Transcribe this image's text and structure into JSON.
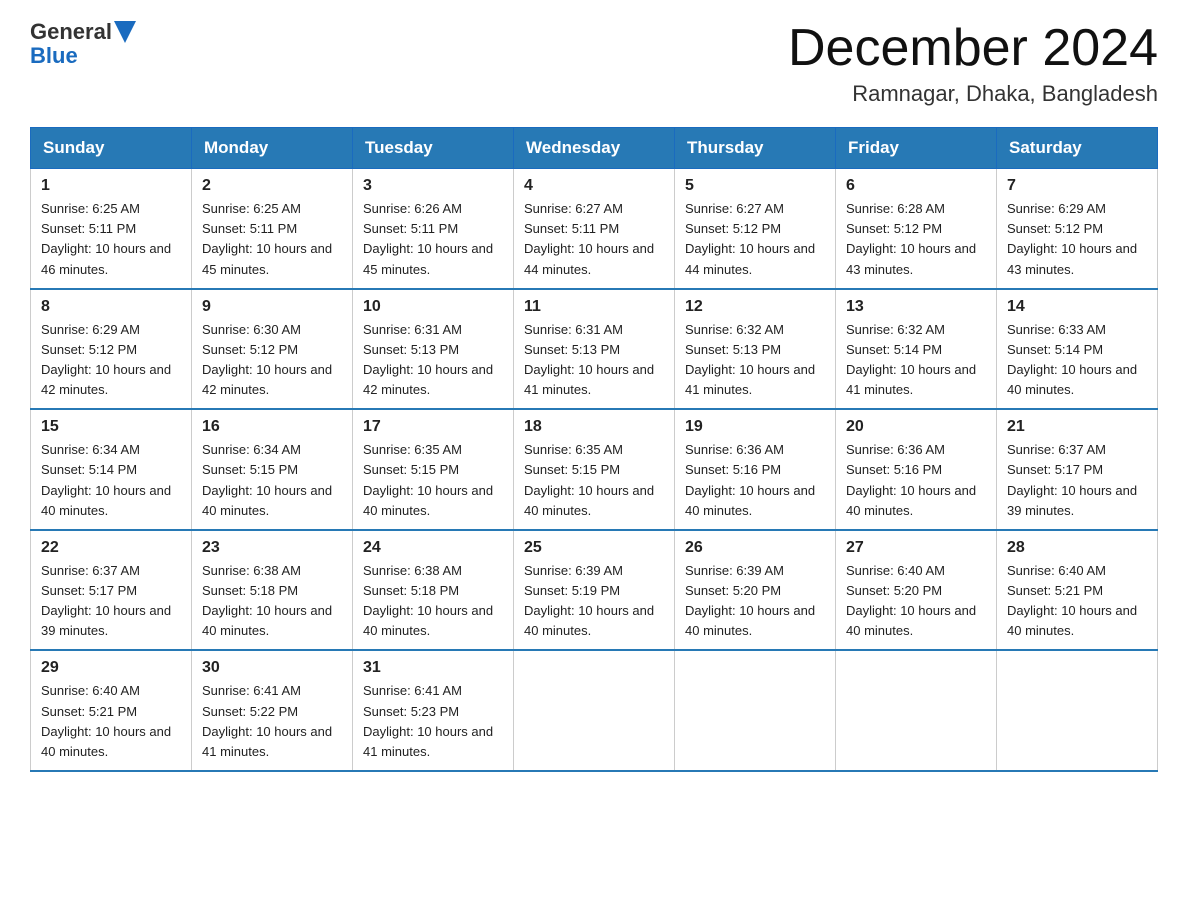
{
  "header": {
    "logo_general": "General",
    "logo_blue": "Blue",
    "month_title": "December 2024",
    "location": "Ramnagar, Dhaka, Bangladesh"
  },
  "days_of_week": [
    "Sunday",
    "Monday",
    "Tuesday",
    "Wednesday",
    "Thursday",
    "Friday",
    "Saturday"
  ],
  "weeks": [
    [
      {
        "day": "1",
        "sunrise": "6:25 AM",
        "sunset": "5:11 PM",
        "daylight": "10 hours and 46 minutes."
      },
      {
        "day": "2",
        "sunrise": "6:25 AM",
        "sunset": "5:11 PM",
        "daylight": "10 hours and 45 minutes."
      },
      {
        "day": "3",
        "sunrise": "6:26 AM",
        "sunset": "5:11 PM",
        "daylight": "10 hours and 45 minutes."
      },
      {
        "day": "4",
        "sunrise": "6:27 AM",
        "sunset": "5:11 PM",
        "daylight": "10 hours and 44 minutes."
      },
      {
        "day": "5",
        "sunrise": "6:27 AM",
        "sunset": "5:12 PM",
        "daylight": "10 hours and 44 minutes."
      },
      {
        "day": "6",
        "sunrise": "6:28 AM",
        "sunset": "5:12 PM",
        "daylight": "10 hours and 43 minutes."
      },
      {
        "day": "7",
        "sunrise": "6:29 AM",
        "sunset": "5:12 PM",
        "daylight": "10 hours and 43 minutes."
      }
    ],
    [
      {
        "day": "8",
        "sunrise": "6:29 AM",
        "sunset": "5:12 PM",
        "daylight": "10 hours and 42 minutes."
      },
      {
        "day": "9",
        "sunrise": "6:30 AM",
        "sunset": "5:12 PM",
        "daylight": "10 hours and 42 minutes."
      },
      {
        "day": "10",
        "sunrise": "6:31 AM",
        "sunset": "5:13 PM",
        "daylight": "10 hours and 42 minutes."
      },
      {
        "day": "11",
        "sunrise": "6:31 AM",
        "sunset": "5:13 PM",
        "daylight": "10 hours and 41 minutes."
      },
      {
        "day": "12",
        "sunrise": "6:32 AM",
        "sunset": "5:13 PM",
        "daylight": "10 hours and 41 minutes."
      },
      {
        "day": "13",
        "sunrise": "6:32 AM",
        "sunset": "5:14 PM",
        "daylight": "10 hours and 41 minutes."
      },
      {
        "day": "14",
        "sunrise": "6:33 AM",
        "sunset": "5:14 PM",
        "daylight": "10 hours and 40 minutes."
      }
    ],
    [
      {
        "day": "15",
        "sunrise": "6:34 AM",
        "sunset": "5:14 PM",
        "daylight": "10 hours and 40 minutes."
      },
      {
        "day": "16",
        "sunrise": "6:34 AM",
        "sunset": "5:15 PM",
        "daylight": "10 hours and 40 minutes."
      },
      {
        "day": "17",
        "sunrise": "6:35 AM",
        "sunset": "5:15 PM",
        "daylight": "10 hours and 40 minutes."
      },
      {
        "day": "18",
        "sunrise": "6:35 AM",
        "sunset": "5:15 PM",
        "daylight": "10 hours and 40 minutes."
      },
      {
        "day": "19",
        "sunrise": "6:36 AM",
        "sunset": "5:16 PM",
        "daylight": "10 hours and 40 minutes."
      },
      {
        "day": "20",
        "sunrise": "6:36 AM",
        "sunset": "5:16 PM",
        "daylight": "10 hours and 40 minutes."
      },
      {
        "day": "21",
        "sunrise": "6:37 AM",
        "sunset": "5:17 PM",
        "daylight": "10 hours and 39 minutes."
      }
    ],
    [
      {
        "day": "22",
        "sunrise": "6:37 AM",
        "sunset": "5:17 PM",
        "daylight": "10 hours and 39 minutes."
      },
      {
        "day": "23",
        "sunrise": "6:38 AM",
        "sunset": "5:18 PM",
        "daylight": "10 hours and 40 minutes."
      },
      {
        "day": "24",
        "sunrise": "6:38 AM",
        "sunset": "5:18 PM",
        "daylight": "10 hours and 40 minutes."
      },
      {
        "day": "25",
        "sunrise": "6:39 AM",
        "sunset": "5:19 PM",
        "daylight": "10 hours and 40 minutes."
      },
      {
        "day": "26",
        "sunrise": "6:39 AM",
        "sunset": "5:20 PM",
        "daylight": "10 hours and 40 minutes."
      },
      {
        "day": "27",
        "sunrise": "6:40 AM",
        "sunset": "5:20 PM",
        "daylight": "10 hours and 40 minutes."
      },
      {
        "day": "28",
        "sunrise": "6:40 AM",
        "sunset": "5:21 PM",
        "daylight": "10 hours and 40 minutes."
      }
    ],
    [
      {
        "day": "29",
        "sunrise": "6:40 AM",
        "sunset": "5:21 PM",
        "daylight": "10 hours and 40 minutes."
      },
      {
        "day": "30",
        "sunrise": "6:41 AM",
        "sunset": "5:22 PM",
        "daylight": "10 hours and 41 minutes."
      },
      {
        "day": "31",
        "sunrise": "6:41 AM",
        "sunset": "5:23 PM",
        "daylight": "10 hours and 41 minutes."
      },
      null,
      null,
      null,
      null
    ]
  ]
}
